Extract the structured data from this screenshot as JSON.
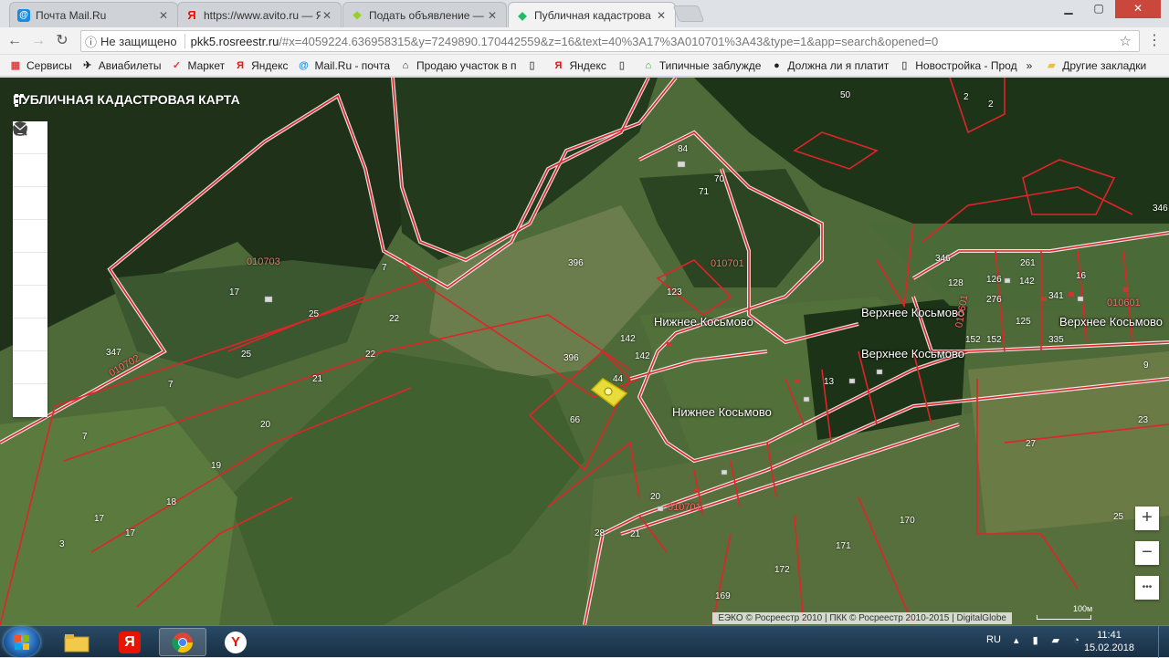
{
  "browser": {
    "tabs": [
      {
        "title": "Почта Mail.Ru",
        "icon": "mail-ru-icon",
        "color": "#168de2",
        "glyph": "@"
      },
      {
        "title": "https://www.avito.ru — Я",
        "icon": "yandex-icon",
        "color": "#e61400",
        "glyph": "Я"
      },
      {
        "title": "Подать объявление — О",
        "icon": "avito-icon",
        "color": "#97cf26",
        "glyph": "●"
      },
      {
        "title": "Публичная кадастрова",
        "icon": "rosreestr-icon",
        "color": "#ffffff",
        "glyph": "◆"
      }
    ],
    "address": {
      "security": "Не защищено",
      "host": "pkk5.rosreestr.ru",
      "path": "/#x=4059224.636958315&y=7249890.170442559&z=16&text=40%3A17%3A010701%3A43&type=1&app=search&opened=0"
    },
    "bookmarks": [
      {
        "label": "Сервисы",
        "icon": "apps-grid-icon",
        "glyph": "▦",
        "color": "#d44"
      },
      {
        "label": "Авиабилеты",
        "icon": "airplane-icon",
        "glyph": "✈",
        "color": "#222"
      },
      {
        "label": "Маркет",
        "icon": "market-icon",
        "glyph": "✓",
        "color": "#e33"
      },
      {
        "label": "Яндекс",
        "icon": "yandex-icon",
        "glyph": "Я",
        "color": "#e61400"
      },
      {
        "label": "Mail.Ru - почта",
        "icon": "mail-ru-icon",
        "glyph": "@",
        "color": "#168de2"
      },
      {
        "label": "Продаю участок в п",
        "icon": "home-icon",
        "glyph": "⌂",
        "color": "#222"
      },
      {
        "label": "",
        "icon": "page-icon",
        "glyph": "▯",
        "color": "#666"
      },
      {
        "label": "Яндекс",
        "icon": "yandex-icon",
        "glyph": "Я",
        "color": "#e61400"
      },
      {
        "label": "",
        "icon": "page-icon",
        "glyph": "▯",
        "color": "#666"
      },
      {
        "label": "Типичные заблужде",
        "icon": "green-home-icon",
        "glyph": "⌂",
        "color": "#2a2"
      },
      {
        "label": "Должна ли я платит",
        "icon": "zen-icon",
        "glyph": "●",
        "color": "#000"
      },
      {
        "label": "Новостройка - Прод",
        "icon": "page-icon",
        "glyph": "▯",
        "color": "#666"
      },
      {
        "label": "Другие закладки",
        "icon": "folder-icon",
        "glyph": "▰",
        "color": "#e8c23a"
      }
    ],
    "more_bookmarks": "»"
  },
  "map": {
    "title": "ПУБЛИЧНАЯ КАДАСТРОВАЯ КАРТА",
    "tools": [
      {
        "icon": "search-icon",
        "glyph": "⌕"
      },
      {
        "icon": "info-icon",
        "glyph": "ⓘ"
      },
      {
        "icon": "layers-icon",
        "glyph": "◈"
      },
      {
        "icon": "pencil-icon",
        "glyph": "✎"
      },
      {
        "icon": "ruler-icon",
        "glyph": "✐"
      },
      {
        "icon": "star-icon",
        "glyph": "★"
      },
      {
        "icon": "print-icon",
        "glyph": "▤"
      },
      {
        "icon": "help-icon",
        "glyph": "?"
      },
      {
        "icon": "mail-icon",
        "glyph": "✉"
      }
    ],
    "places": [
      {
        "text": "Нижнее Косьмово"
      },
      {
        "text": "Верхнее Косьмово"
      },
      {
        "text": "Верхнее Косьмово"
      },
      {
        "text": "Нижнее Косьмово"
      },
      {
        "text": "Верхнее Косьмово"
      }
    ],
    "blocks": [
      "010703",
      "010702",
      "010701",
      "010701",
      "010601",
      "010601"
    ],
    "parcels": [
      "50",
      "2",
      "2",
      "346",
      "84",
      "71",
      "70",
      "396",
      "396",
      "7",
      "7",
      "17",
      "25",
      "22",
      "22",
      "25",
      "21",
      "20",
      "19",
      "18",
      "17",
      "17",
      "347",
      "7",
      "3",
      "123",
      "142",
      "142",
      "44",
      "66",
      "28",
      "346",
      "261",
      "16",
      "128",
      "126",
      "276",
      "142",
      "341",
      "125",
      "152",
      "152",
      "335",
      "13",
      "9",
      "27",
      "23",
      "25",
      "170",
      "171",
      "172",
      "169",
      "20",
      "21"
    ],
    "zoom_in": "+",
    "zoom_out": "−",
    "more": "•••",
    "attribution": "ЕЭКО © Росреестр 2010 | ПКК © Росреестр 2010-2015 | DigitalGlobe",
    "scale": "100м"
  },
  "taskbar": {
    "apps": [
      {
        "icon": "file-explorer-icon"
      },
      {
        "icon": "yandex-browser-icon",
        "glyph": "Я"
      },
      {
        "icon": "chrome-icon"
      },
      {
        "icon": "yandex-icon",
        "glyph": "Y"
      }
    ],
    "lang": "RU",
    "time": "11:41",
    "date": "15.02.2018"
  }
}
